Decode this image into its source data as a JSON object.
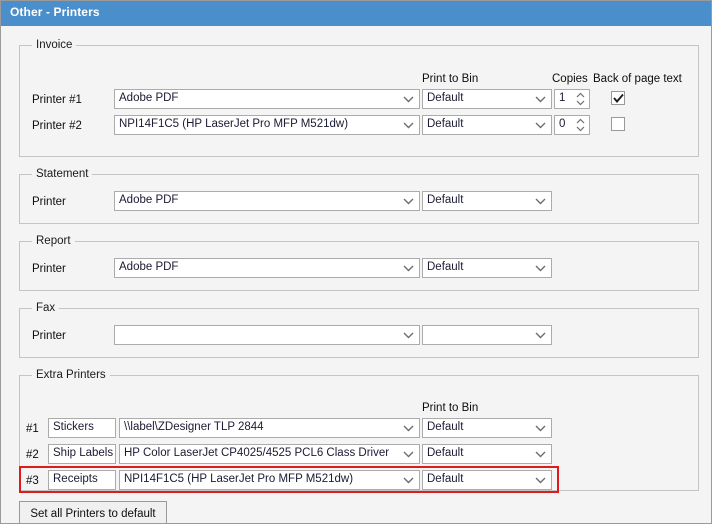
{
  "window": {
    "title": "Other - Printers",
    "titlebar_color": "#4a8ecb",
    "background_color": "#f4f4f4",
    "highlight_color": "#e01b1b"
  },
  "sections": {
    "invoice": {
      "title": "Invoice",
      "column_headers": {
        "print_to_bin": "Print to Bin",
        "copies": "Copies",
        "back_of_page_text": "Back of page text"
      },
      "rows": [
        {
          "label": "Printer #1",
          "printer": "Adobe PDF",
          "bin": "Default",
          "copies": "1",
          "back_of_page": true
        },
        {
          "label": "Printer #2",
          "printer": "NPI14F1C5 (HP LaserJet Pro MFP M521dw)",
          "bin": "Default",
          "copies": "0",
          "back_of_page": false
        }
      ]
    },
    "statement": {
      "title": "Statement",
      "row": {
        "label": "Printer",
        "printer": "Adobe PDF",
        "bin": "Default"
      }
    },
    "report": {
      "title": "Report",
      "row": {
        "label": "Printer",
        "printer": "Adobe PDF",
        "bin": "Default"
      }
    },
    "fax": {
      "title": "Fax",
      "row": {
        "label": "Printer",
        "printer": "",
        "bin": ""
      }
    },
    "extra_printers": {
      "title": "Extra Printers",
      "column_headers": {
        "print_to_bin": "Print to Bin"
      },
      "rows": [
        {
          "index": "#1",
          "name": "Stickers",
          "printer": "\\\\label\\ZDesigner TLP 2844",
          "bin": "Default",
          "highlighted": false
        },
        {
          "index": "#2",
          "name": "Ship Labels",
          "printer": "HP Color LaserJet CP4025/4525 PCL6 Class Driver",
          "bin": "Default",
          "highlighted": false
        },
        {
          "index": "#3",
          "name": "Receipts",
          "printer": "NPI14F1C5 (HP LaserJet Pro MFP M521dw)",
          "bin": "Default",
          "highlighted": true
        }
      ]
    }
  },
  "footer": {
    "set_default_button": "Set all Printers to default"
  }
}
